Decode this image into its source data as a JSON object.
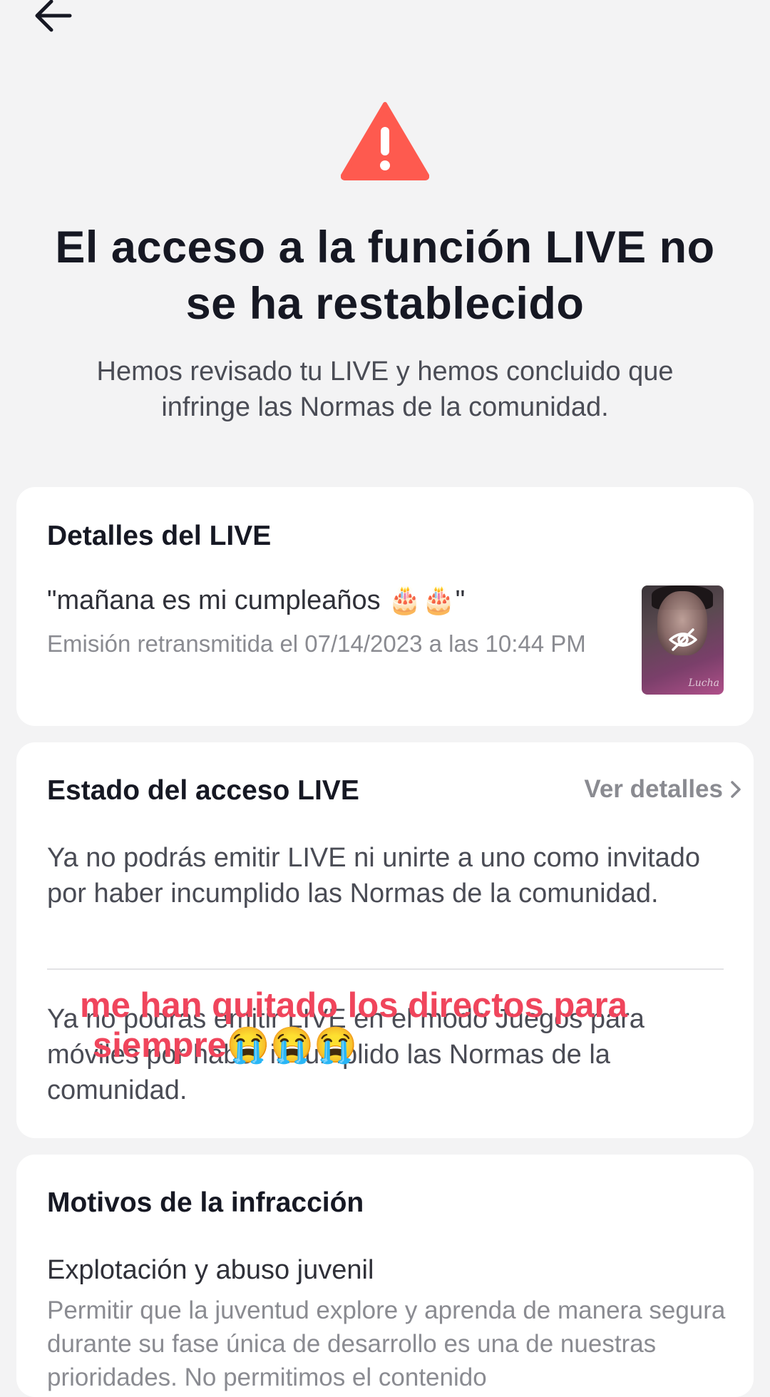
{
  "header": {
    "back_icon": "arrow-left-icon"
  },
  "alert": {
    "icon": "warning-triangle-icon",
    "icon_color": "#fe5a4f",
    "title": "El acceso a la función LIVE no se ha restablecido",
    "subtitle": "Hemos revisado tu LIVE y hemos concluido que infringe las Normas de la comunidad."
  },
  "live_details": {
    "title": "Detalles del LIVE",
    "name": "\"mañana es mi cumpleaños 🎂🎂\"",
    "broadcast_info": "Emisión retransmitida el 07/14/2023 a las 10:44 PM",
    "thumbnail_icon": "eye-off-icon"
  },
  "access_status": {
    "title": "Estado del acceso LIVE",
    "see_details_label": "Ver detalles",
    "see_details_icon": "chevron-right-icon",
    "items": [
      "Ya no podrás emitir LIVE ni unirte a uno como invitado por haber incumplido las Normas de la comunidad.",
      "Ya no podrás emitir LIVE en el modo Juegos para móviles por haber incumplido las Normas de la comunidad."
    ]
  },
  "overlay_caption": {
    "line1": "me han quitado los directos para",
    "line2": "siempre😭😭😭",
    "color": "#f0455c"
  },
  "violation_reasons": {
    "title": "Motivos de la infracción",
    "reason_title": "Explotación y abuso juvenil",
    "reason_description": "Permitir que la juventud explore y aprenda de manera segura durante su fase única de desarrollo es una de nuestras prioridades. No permitimos el contenido"
  }
}
